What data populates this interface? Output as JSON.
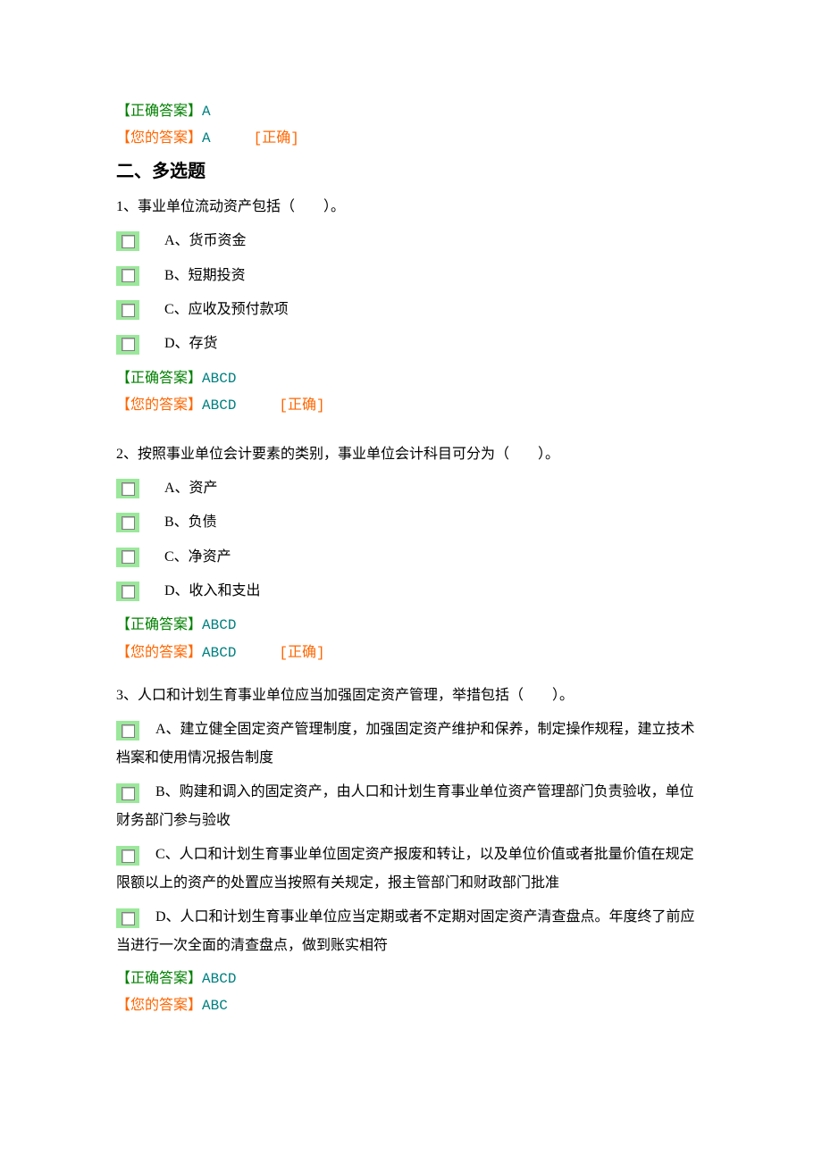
{
  "prev_answer": {
    "correct_label": "【正确答案】",
    "correct_value": "A",
    "your_label": "【您的答案】",
    "your_value": "A",
    "judgement": "[正确]"
  },
  "section_heading": "二、多选题",
  "questions": [
    {
      "stem": "1、事业单位流动资产包括（　　）。",
      "options": [
        "A、货币资金",
        "B、短期投资",
        "C、应收及预付款项",
        "D、存货"
      ],
      "correct_label": "【正确答案】",
      "correct_value": "ABCD",
      "your_label": "【您的答案】",
      "your_value": "ABCD",
      "judgement": "[正确]"
    },
    {
      "stem": "2、按照事业单位会计要素的类别，事业单位会计科目可分为（　　）。",
      "options": [
        "A、资产",
        "B、负债",
        "C、净资产",
        "D、收入和支出"
      ],
      "correct_label": "【正确答案】",
      "correct_value": "ABCD",
      "your_label": "【您的答案】",
      "your_value": "ABCD",
      "judgement": "[正确]"
    },
    {
      "stem": "3、人口和计划生育事业单位应当加强固定资产管理，举措包括（　　）。",
      "options": [
        "A、建立健全固定资产管理制度，加强固定资产维护和保养，制定操作规程，建立技术档案和使用情况报告制度",
        "B、购建和调入的固定资产，由人口和计划生育事业单位资产管理部门负责验收，单位财务部门参与验收",
        "C、人口和计划生育事业单位固定资产报废和转让，以及单位价值或者批量价值在规定限额以上的资产的处置应当按照有关规定，报主管部门和财政部门批准",
        "D、人口和计划生育事业单位应当定期或者不定期对固定资产清查盘点。年度终了前应当进行一次全面的清查盘点，做到账实相符"
      ],
      "correct_label": "【正确答案】",
      "correct_value": "ABCD",
      "your_label": "【您的答案】",
      "your_value": "ABC",
      "judgement": ""
    }
  ]
}
